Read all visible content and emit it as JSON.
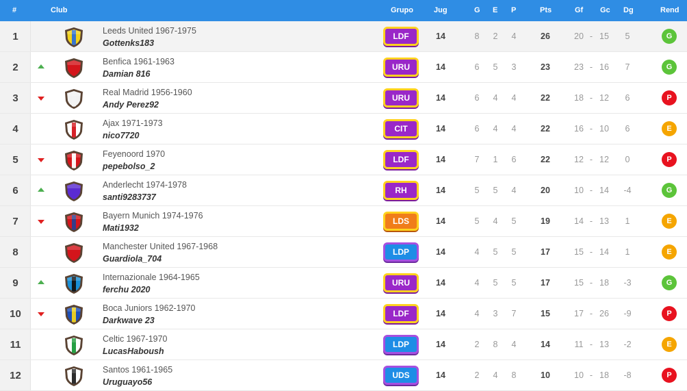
{
  "header": {
    "pos": "#",
    "club": "Club",
    "grupo": "Grupo",
    "jug": "Jug",
    "g": "G",
    "e": "E",
    "p": "P",
    "pts": "Pts",
    "gf": "Gf",
    "gc": "Gc",
    "dg": "Dg",
    "rend": "Rend"
  },
  "rows": [
    {
      "pos": "1",
      "trend": "none",
      "club": "Leeds United 1967-1975",
      "manager": "Gottenks183",
      "group": "LDF",
      "jug": "14",
      "g": "8",
      "e": "2",
      "p": "4",
      "pts": "26",
      "gf": "20",
      "sep": "-",
      "gc": "15",
      "dg": "5",
      "rend": "G",
      "badge": {
        "main": "#f2d21b",
        "stripe": "#2d6fd6",
        "rim": "#5a4333"
      }
    },
    {
      "pos": "2",
      "trend": "up",
      "club": "Benfica 1961-1963",
      "manager": "Damian 816",
      "group": "URU",
      "jug": "14",
      "g": "6",
      "e": "5",
      "p": "3",
      "pts": "23",
      "gf": "23",
      "sep": "-",
      "gc": "16",
      "dg": "7",
      "rend": "G",
      "badge": {
        "main": "#d4151b",
        "stripe": "#d4151b",
        "rim": "#5a4333"
      }
    },
    {
      "pos": "3",
      "trend": "down",
      "club": "Real Madrid 1956-1960",
      "manager": "Andy Perez92",
      "group": "URU",
      "jug": "14",
      "g": "6",
      "e": "4",
      "p": "4",
      "pts": "22",
      "gf": "18",
      "sep": "-",
      "gc": "12",
      "dg": "6",
      "rend": "P",
      "badge": {
        "main": "#f2f2f2",
        "stripe": "#f2f2f2",
        "rim": "#5a4333"
      }
    },
    {
      "pos": "4",
      "trend": "none",
      "club": "Ajax 1971-1973",
      "manager": "nico7720",
      "group": "CIT",
      "jug": "14",
      "g": "6",
      "e": "4",
      "p": "4",
      "pts": "22",
      "gf": "16",
      "sep": "-",
      "gc": "10",
      "dg": "6",
      "rend": "E",
      "badge": {
        "main": "#ffffff",
        "stripe": "#d4151b",
        "rim": "#5a4333"
      }
    },
    {
      "pos": "5",
      "trend": "down",
      "club": "Feyenoord 1970",
      "manager": "pepebolso_2",
      "group": "LDF",
      "jug": "14",
      "g": "7",
      "e": "1",
      "p": "6",
      "pts": "22",
      "gf": "12",
      "sep": "-",
      "gc": "12",
      "dg": "0",
      "rend": "P",
      "badge": {
        "main": "#d4151b",
        "stripe": "#ffffff",
        "rim": "#5a4333"
      }
    },
    {
      "pos": "6",
      "trend": "up",
      "club": "Anderlecht 1974-1978",
      "manager": "santi9283737",
      "group": "RH",
      "jug": "14",
      "g": "5",
      "e": "5",
      "p": "4",
      "pts": "20",
      "gf": "10",
      "sep": "-",
      "gc": "14",
      "dg": "-4",
      "rend": "G",
      "badge": {
        "main": "#5b2bd1",
        "stripe": "#5b2bd1",
        "rim": "#5a4333"
      }
    },
    {
      "pos": "7",
      "trend": "down",
      "club": "Bayern Munich 1974-1976",
      "manager": "Mati1932",
      "group": "LDS",
      "jug": "14",
      "g": "5",
      "e": "4",
      "p": "5",
      "pts": "19",
      "gf": "14",
      "sep": "-",
      "gc": "13",
      "dg": "1",
      "rend": "E",
      "badge": {
        "main": "#d4151b",
        "stripe": "#2a3f8f",
        "rim": "#5a4333"
      }
    },
    {
      "pos": "8",
      "trend": "none",
      "club": "Manchester United 1967-1968",
      "manager": "Guardiola_704",
      "group": "LDP",
      "jug": "14",
      "g": "4",
      "e": "5",
      "p": "5",
      "pts": "17",
      "gf": "15",
      "sep": "-",
      "gc": "14",
      "dg": "1",
      "rend": "E",
      "badge": {
        "main": "#d4151b",
        "stripe": "#d4151b",
        "rim": "#5a4333"
      }
    },
    {
      "pos": "9",
      "trend": "up",
      "club": "Internazionale 1964-1965",
      "manager": "ferchu 2020",
      "group": "URU",
      "jug": "14",
      "g": "4",
      "e": "5",
      "p": "5",
      "pts": "17",
      "gf": "15",
      "sep": "-",
      "gc": "18",
      "dg": "-3",
      "rend": "G",
      "badge": {
        "main": "#1a8fd6",
        "stripe": "#111111",
        "rim": "#5a4333"
      }
    },
    {
      "pos": "10",
      "trend": "down",
      "club": "Boca Juniors 1962-1970",
      "manager": "Darkwave 23",
      "group": "LDF",
      "jug": "14",
      "g": "4",
      "e": "3",
      "p": "7",
      "pts": "15",
      "gf": "17",
      "sep": "-",
      "gc": "26",
      "dg": "-9",
      "rend": "P",
      "badge": {
        "main": "#1d4fb8",
        "stripe": "#f2d21b",
        "rim": "#5a4333"
      }
    },
    {
      "pos": "11",
      "trend": "none",
      "club": "Celtic 1967-1970",
      "manager": "LucasHaboush",
      "group": "LDP",
      "jug": "14",
      "g": "2",
      "e": "8",
      "p": "4",
      "pts": "14",
      "gf": "11",
      "sep": "-",
      "gc": "13",
      "dg": "-2",
      "rend": "E",
      "badge": {
        "main": "#ffffff",
        "stripe": "#1a9a3a",
        "rim": "#5a4333"
      }
    },
    {
      "pos": "12",
      "trend": "none",
      "club": "Santos 1961-1965",
      "manager": "Uruguayo56",
      "group": "UDS",
      "jug": "14",
      "g": "2",
      "e": "4",
      "p": "8",
      "pts": "10",
      "gf": "10",
      "sep": "-",
      "gc": "18",
      "dg": "-8",
      "rend": "P",
      "badge": {
        "main": "#ffffff",
        "stripe": "#222222",
        "rim": "#5a4333"
      }
    }
  ]
}
